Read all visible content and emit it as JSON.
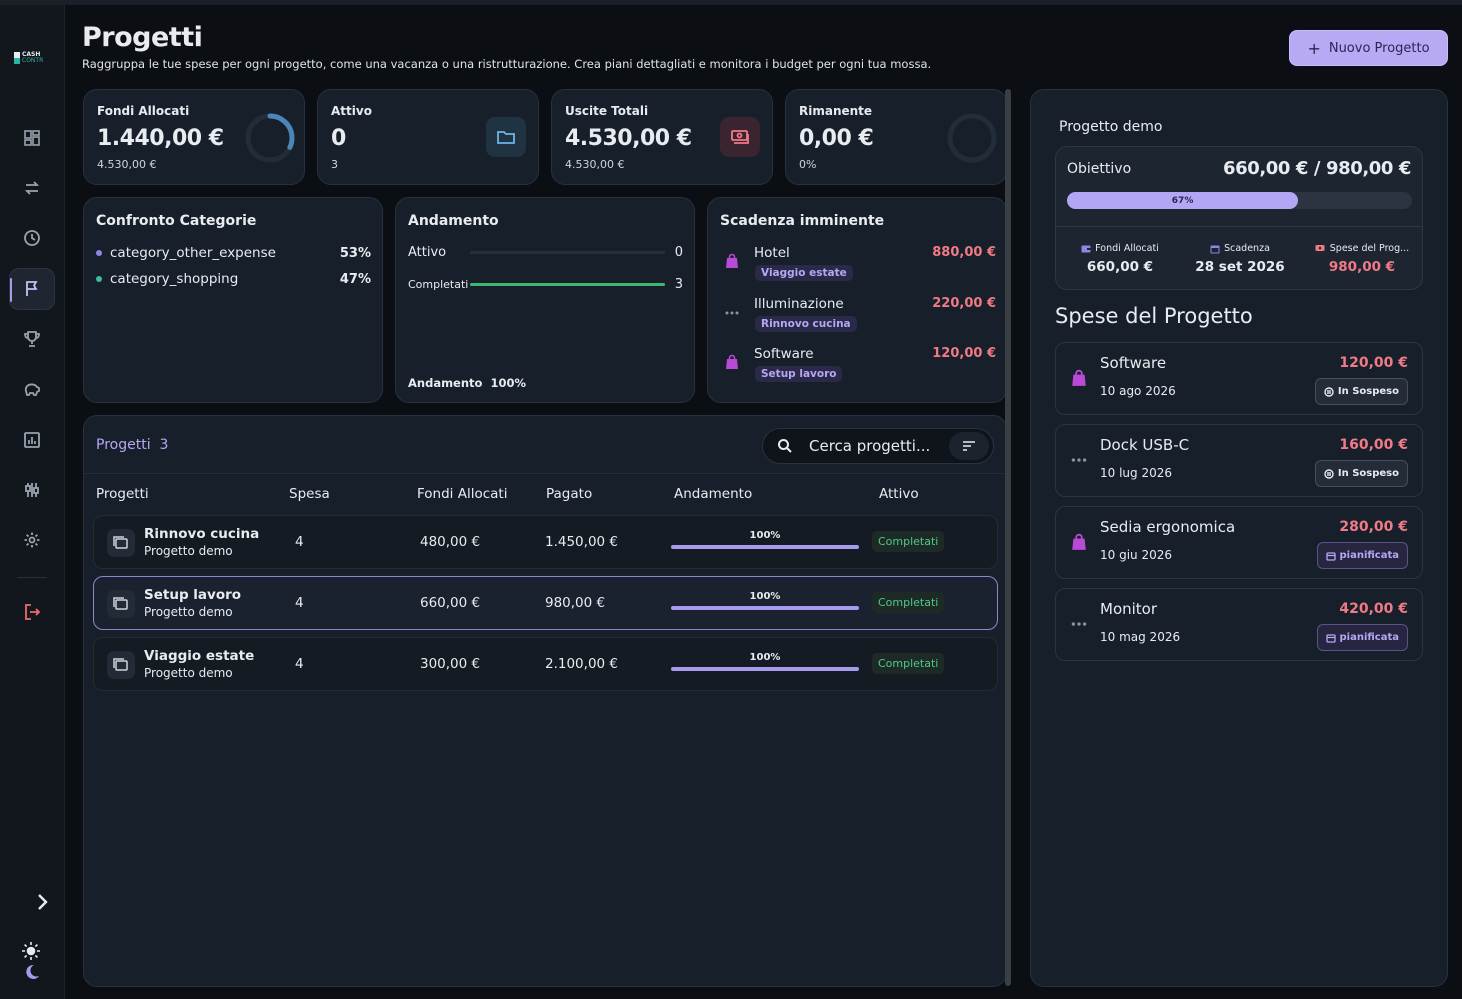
{
  "app": {
    "logo_line1": "CASH",
    "logo_line2": "CONTR"
  },
  "header": {
    "title": "Progetti",
    "subtitle": "Raggruppa le tue spese per ogni progetto, come una vacanza o una ristrutturazione. Crea piani dettagliati e monitora i budget per ogni tua mossa.",
    "new_button": "Nuovo Progetto"
  },
  "sidebar": {
    "items": [
      {
        "icon": "dashboard-icon"
      },
      {
        "icon": "transfer-icon"
      },
      {
        "icon": "clock-icon"
      },
      {
        "icon": "flag-icon",
        "active": true
      },
      {
        "icon": "trophy-icon"
      },
      {
        "icon": "piggy-bank-icon"
      },
      {
        "icon": "report-icon"
      },
      {
        "icon": "sliders-icon"
      },
      {
        "icon": "gear-icon"
      },
      {
        "icon": "logout-icon"
      }
    ]
  },
  "stats": [
    {
      "label": "Fondi Allocati",
      "value": "1.440,00 €",
      "sub": "4.530,00 €",
      "ring_fraction": 0.32
    },
    {
      "label": "Attivo",
      "value": "0",
      "sub": "3",
      "icon": "folder-icon"
    },
    {
      "label": "Uscite Totali",
      "value": "4.530,00 €",
      "sub": "4.530,00 €",
      "icon": "cash-icon"
    },
    {
      "label": "Rimanente",
      "value": "0,00 €",
      "sub": "0%",
      "ring_fraction": 0
    }
  ],
  "categories": {
    "title": "Confronto Categorie",
    "items": [
      {
        "name": "category_other_expense",
        "pct": "53%",
        "color": "#8f86e8"
      },
      {
        "name": "category_shopping",
        "pct": "47%",
        "color": "#3fb8a5"
      }
    ]
  },
  "trend": {
    "title": "Andamento",
    "rows": [
      {
        "label": "Attivo",
        "value": "0",
        "fraction": 0
      },
      {
        "label": "Completati",
        "value": "3",
        "fraction": 1
      }
    ],
    "footer_label": "Andamento",
    "footer_value": "100%"
  },
  "due": {
    "title": "Scadenza imminente",
    "items": [
      {
        "name": "Hotel",
        "amount": "880,00 €",
        "tag": "Viaggio estate",
        "icon": "shopping-bag-icon"
      },
      {
        "name": "Illuminazione",
        "amount": "220,00 €",
        "tag": "Rinnovo cucina",
        "icon": "more-icon"
      },
      {
        "name": "Software",
        "amount": "120,00 €",
        "tag": "Setup lavoro",
        "icon": "shopping-bag-icon"
      }
    ]
  },
  "projects": {
    "title": "Progetti",
    "count": "3",
    "search_placeholder": "Cerca progetti...",
    "columns": [
      "Progetti",
      "Spesa",
      "Fondi Allocati",
      "Pagato",
      "Andamento",
      "Attivo"
    ],
    "rows": [
      {
        "name": "Rinnovo cucina",
        "sub": "Progetto demo",
        "spesa": "4",
        "fondi": "480,00 €",
        "pagato": "1.450,00 €",
        "progress": "100%",
        "status": "Completati"
      },
      {
        "name": "Setup lavoro",
        "sub": "Progetto demo",
        "spesa": "4",
        "fondi": "660,00 €",
        "pagato": "980,00 €",
        "progress": "100%",
        "status": "Completati",
        "selected": true
      },
      {
        "name": "Viaggio estate",
        "sub": "Progetto demo",
        "spesa": "4",
        "fondi": "300,00 €",
        "pagato": "2.100,00 €",
        "progress": "100%",
        "status": "Completati"
      }
    ]
  },
  "detail": {
    "title": "Progetto demo",
    "goal_label": "Obiettivo",
    "goal_value": "660,00 € / 980,00 €",
    "goal_pct": "67%",
    "goal_fraction": 0.67,
    "stats": [
      {
        "label": "Fondi Allocati",
        "value": "660,00 €",
        "icon": "wallet-icon"
      },
      {
        "label": "Scadenza",
        "value": "28 set 2026",
        "icon": "calendar-icon"
      },
      {
        "label": "Spese del Prog...",
        "value": "980,00 €",
        "icon": "cash-icon"
      }
    ],
    "expenses_title": "Spese del Progetto",
    "expenses": [
      {
        "name": "Software",
        "date": "10 ago 2026",
        "amount": "120,00 €",
        "badge": "In Sospeso",
        "icon": "shopping-bag-icon"
      },
      {
        "name": "Dock USB-C",
        "date": "10 lug 2026",
        "amount": "160,00 €",
        "badge": "In Sospeso",
        "icon": "more-icon"
      },
      {
        "name": "Sedia ergonomica",
        "date": "10 giu 2026",
        "amount": "280,00 €",
        "badge": "pianificata",
        "icon": "shopping-bag-icon"
      },
      {
        "name": "Monitor",
        "date": "10 mag 2026",
        "amount": "420,00 €",
        "badge": "pianificata",
        "icon": "more-icon"
      }
    ]
  }
}
